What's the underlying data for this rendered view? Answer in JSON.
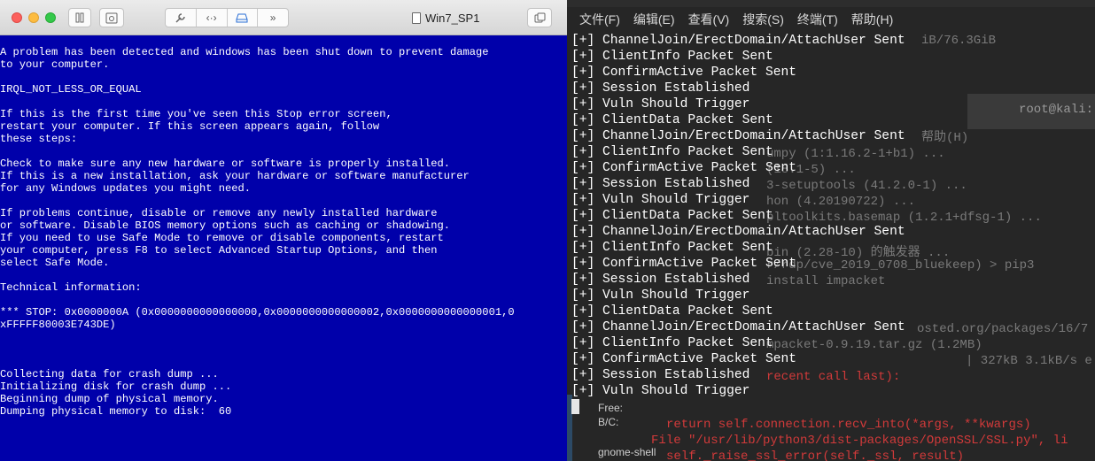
{
  "vm": {
    "title": "Win7_SP1",
    "bsod_text": "A problem has been detected and windows has been shut down to prevent damage\nto your computer.\n\nIRQL_NOT_LESS_OR_EQUAL\n\nIf this is the first time you've seen this Stop error screen,\nrestart your computer. If this screen appears again, follow\nthese steps:\n\nCheck to make sure any new hardware or software is properly installed.\nIf this is a new installation, ask your hardware or software manufacturer\nfor any Windows updates you might need.\n\nIf problems continue, disable or remove any newly installed hardware\nor software. Disable BIOS memory options such as caching or shadowing.\nIf you need to use Safe Mode to remove or disable components, restart\nyour computer, press F8 to select Advanced Startup Options, and then\nselect Safe Mode.\n\nTechnical information:\n\n*** STOP: 0x0000000A (0x0000000000000000,0x0000000000000002,0x0000000000000001,0\nxFFFFF80003E743DE)\n\n\n\nCollecting data for crash dump ...\nInitializing disk for crash dump ...\nBeginning dump of physical memory.\nDumping physical memory to disk:  60"
  },
  "terminal": {
    "menu": [
      "文件(F)",
      "编辑(E)",
      "查看(V)",
      "搜索(S)",
      "终端(T)",
      "帮助(H)"
    ],
    "lines": [
      "[+] ChannelJoin/ErectDomain/AttachUser Sent",
      "[+] ClientInfo Packet Sent",
      "[+] ConfirmActive Packet Sent",
      "[+] Session Established",
      "[+] Vuln Should Trigger",
      "[+] ClientData Packet Sent",
      "[+] ChannelJoin/ErectDomain/AttachUser Sent",
      "[+] ClientInfo Packet Sent",
      "[+] ConfirmActive Packet Sent",
      "[+] Session Established",
      "[+] Vuln Should Trigger",
      "[+] ClientData Packet Sent",
      "[+] ChannelJoin/ErectDomain/AttachUser Sent",
      "[+] ClientInfo Packet Sent",
      "[+] ConfirmActive Packet Sent",
      "[+] Session Established",
      "[+] Vuln Should Trigger",
      "[+] ClientData Packet Sent",
      "[+] ChannelJoin/ErectDomain/AttachUser Sent",
      "[+] ClientInfo Packet Sent",
      "[+] ConfirmActive Packet Sent",
      "[+] Session Established",
      "[+] Vuln Should Trigger"
    ],
    "background": {
      "size_info": "iB/76.3GiB",
      "root_title": "root@kali: ~",
      "help_menu": "帮助(H)",
      "pkg1": "umpy (1:1.16.2-1+b1) ...",
      "pkg2": "(18.1-5) ...",
      "pkg3": "3-setuptools (41.2.0-1) ...",
      "pkg4": "hon (4.20190722) ...",
      "pkg5": "pltoolkits.basemap (1.2.1+dfsg-1) ...",
      "pkg6": "bin (2.28-10) 的触发器 ...",
      "prompt": "r/rdp/cve_2019_0708_bluekeep) > pip3",
      "install": "install impacket",
      "hosted": "osted.org/packages/16/7",
      "tarball": "mpacket-0.9.19.tar.gz (1.2MB)",
      "speed": "| 327kB 3.1kB/s e",
      "recent": "recent call last):",
      "free": "Free:",
      "bc": "B/C:",
      "recv": "return self.connection.recv_into(*args, **kwargs)",
      "file": "File \"/usr/lib/python3/dist-packages/OpenSSL/SSL.py\", li",
      "raise": "self._raise_ssl_error(self._ssl, result)",
      "gnome": "gnome-shell"
    }
  },
  "colors": {
    "bsod_blue": "#0000aa",
    "terminal_bg": "#262626",
    "error_red": "#d23a3a"
  }
}
